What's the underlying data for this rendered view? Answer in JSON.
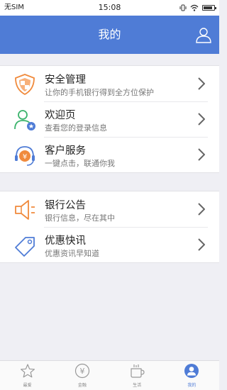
{
  "status_bar": {
    "carrier": "无SIM",
    "time": "15:08"
  },
  "header": {
    "title": "我的"
  },
  "menu_groups": [
    {
      "items": [
        {
          "title": "安全管理",
          "subtitle": "让你的手机银行得到全方位保护",
          "icon": "shield-icon"
        },
        {
          "title": "欢迎页",
          "subtitle": "查看您的登录信息",
          "icon": "welcome-user-icon"
        },
        {
          "title": "客户服务",
          "subtitle": "一键点击，联通你我",
          "icon": "customer-service-icon"
        }
      ]
    },
    {
      "items": [
        {
          "title": "银行公告",
          "subtitle": "银行信息，尽在其中",
          "icon": "speaker-icon"
        },
        {
          "title": "优惠快讯",
          "subtitle": "优惠资讯早知道",
          "icon": "tag-icon"
        }
      ]
    }
  ],
  "tabbar": {
    "items": [
      {
        "label": "最爱",
        "icon": "star-icon",
        "active": false
      },
      {
        "label": "金融",
        "icon": "yuan-icon",
        "active": false
      },
      {
        "label": "生活",
        "icon": "cup-icon",
        "active": false
      },
      {
        "label": "我的",
        "icon": "user-icon",
        "active": true
      }
    ]
  },
  "colors": {
    "accent": "#4f7cd6",
    "background": "#efeff4",
    "orange": "#f08a3c"
  }
}
